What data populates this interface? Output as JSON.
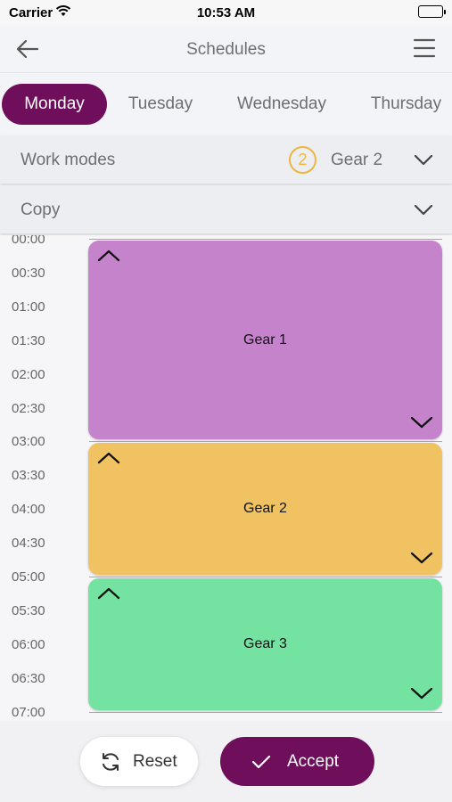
{
  "status_bar": {
    "carrier": "Carrier",
    "time": "10:53 AM"
  },
  "header": {
    "title": "Schedules"
  },
  "days": [
    "Monday",
    "Tuesday",
    "Wednesday",
    "Thursday"
  ],
  "selected_day": "Monday",
  "work_modes": {
    "label": "Work modes",
    "badge": "2",
    "value": "Gear 2"
  },
  "copy": {
    "label": "Copy"
  },
  "timeline": {
    "times": [
      "00:00",
      "00:30",
      "01:00",
      "01:30",
      "02:00",
      "02:30",
      "03:00",
      "03:30",
      "04:00",
      "04:30",
      "05:00",
      "05:30",
      "06:00",
      "06:30",
      "07:00"
    ],
    "blocks": [
      {
        "name": "Gear 1",
        "start": "00:00",
        "end": "03:00",
        "color": "#c583cc"
      },
      {
        "name": "Gear 2",
        "start": "03:00",
        "end": "05:00",
        "color": "#f0c262"
      },
      {
        "name": "Gear 3",
        "start": "05:00",
        "end": "07:00",
        "color": "#74e3a2"
      }
    ]
  },
  "footer": {
    "reset_label": "Reset",
    "accept_label": "Accept"
  },
  "colors": {
    "accent": "#6f0e5a",
    "badge": "#f0b63a"
  }
}
